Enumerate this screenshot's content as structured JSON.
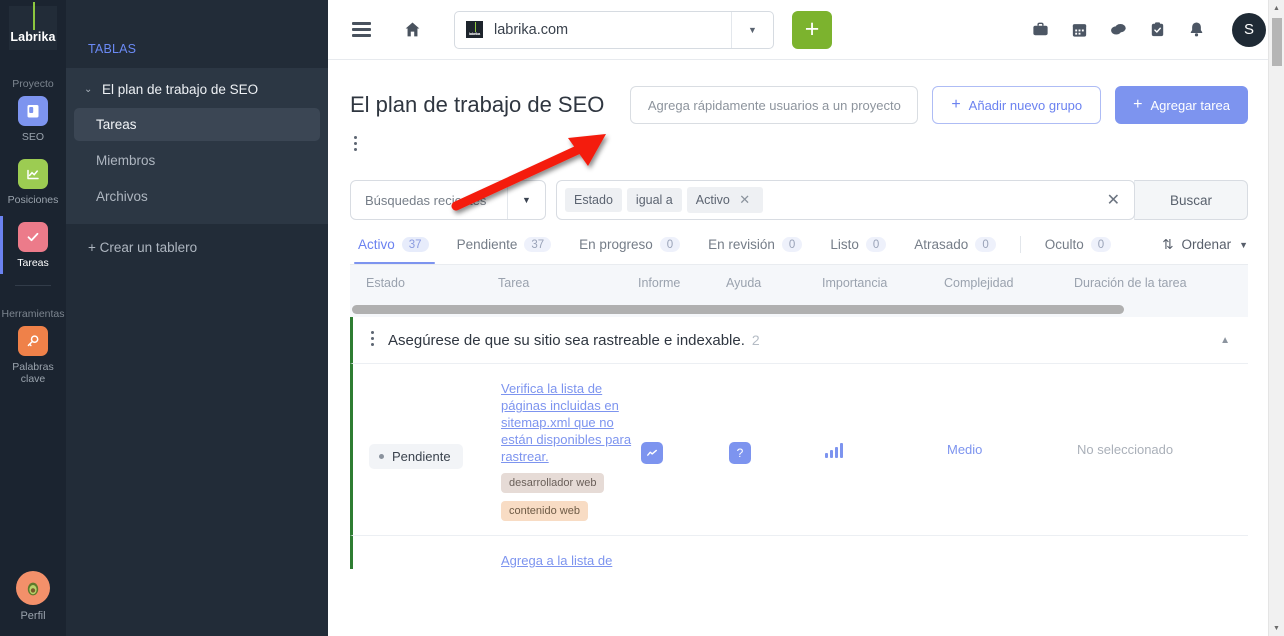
{
  "rail": {
    "logo": "Labrika",
    "project_label": "Proyecto",
    "tools_label": "Herramientas",
    "items": [
      {
        "label": "SEO",
        "icon": "clipboard-seo-icon",
        "color": "#7d94ef"
      },
      {
        "label": "Posiciones",
        "icon": "chart-icon",
        "color": "#9ccc52"
      },
      {
        "label": "Tareas",
        "icon": "check-icon",
        "color": "#ec7b8a"
      }
    ],
    "tools": [
      {
        "label": "Palabras clave",
        "icon": "key-icon",
        "color": "#ef8149"
      }
    ],
    "profile": {
      "label": "Perfil",
      "icon": "avocado-avatar-icon"
    }
  },
  "sidebar": {
    "title": "TABLAS",
    "board": "El plan de trabajo de SEO",
    "items": [
      {
        "label": "Tareas",
        "selected": true
      },
      {
        "label": "Miembros",
        "selected": false
      },
      {
        "label": "Archivos",
        "selected": false
      }
    ],
    "create_board": "+ Crear un tablero"
  },
  "topbar": {
    "url": "labrika.com",
    "plus_label": "+",
    "user_initial": "S",
    "icons": [
      "briefcase-icon",
      "calendar-icon",
      "chat-icon",
      "clipboard-check-icon",
      "bell-icon"
    ]
  },
  "header": {
    "title": "El plan de trabajo de SEO",
    "add_users_placeholder": "Agrega rápidamente usuarios a un proyecto",
    "add_group_label": "Añadir nuevo grupo",
    "add_task_label": "Agregar tarea",
    "plus": "+"
  },
  "search": {
    "recent_label": "Búsquedas recientes",
    "filter_field": "Estado",
    "filter_op": "igual a",
    "filter_value": "Activo",
    "filter_remove": "✕",
    "clear": "✕",
    "search_button": "Buscar"
  },
  "tabs": {
    "items": [
      {
        "label": "Activo",
        "count": "37",
        "active": true
      },
      {
        "label": "Pendiente",
        "count": "37",
        "active": false
      },
      {
        "label": "En progreso",
        "count": "0",
        "active": false
      },
      {
        "label": "En revisión",
        "count": "0",
        "active": false
      },
      {
        "label": "Listo",
        "count": "0",
        "active": false
      },
      {
        "label": "Atrasado",
        "count": "0",
        "active": false
      }
    ],
    "hidden": {
      "label": "Oculto",
      "count": "0"
    },
    "sort_label": "Ordenar"
  },
  "table": {
    "columns": [
      "Estado",
      "Tarea",
      "Informe",
      "Ayuda",
      "Importancia",
      "Complejidad",
      "Duración de la tarea"
    ],
    "group": {
      "title": "Asegúrese de que su sitio sea rastreable e indexable.",
      "count": "2"
    },
    "rows": [
      {
        "status": "Pendiente",
        "task": "Verifica la lista de páginas incluidas en sitemap.xml que no están disponibles para rastrear.",
        "tags": [
          "desarrollador web",
          "contenido web"
        ],
        "informe": "trend-icon",
        "ayuda": "?",
        "importancia": "bars-icon",
        "complejidad": "Medio",
        "duracion": "No seleccionado"
      },
      {
        "task": "Agrega a la lista de",
        "tags": [],
        "complejidad": "",
        "duracion": ""
      }
    ]
  },
  "annotation": {
    "type": "red-arrow",
    "color": "#f41c0c"
  }
}
